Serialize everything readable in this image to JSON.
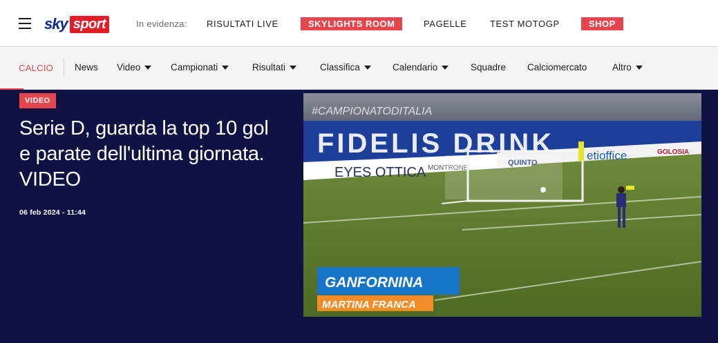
{
  "header": {
    "menu_icon": "hamburger-icon",
    "logo": {
      "sky": "sky",
      "sport": "sport"
    },
    "evidenza_label": "In evidenza:",
    "highlights": [
      {
        "label": "RISULTATI LIVE",
        "tag": false
      },
      {
        "label": "SKYLIGHTS ROOM",
        "tag": true
      },
      {
        "label": "PAGELLE",
        "tag": false
      },
      {
        "label": "TEST MOTOGP",
        "tag": false
      },
      {
        "label": "SHOP",
        "tag": true
      }
    ]
  },
  "subnav": {
    "section": "CALCIO",
    "items": [
      {
        "label": "News",
        "dropdown": false
      },
      {
        "label": "Video",
        "dropdown": true
      },
      {
        "label": "Campionati",
        "dropdown": true
      },
      {
        "label": "Risultati",
        "dropdown": true
      },
      {
        "label": "Classifica",
        "dropdown": true
      },
      {
        "label": "Calendario",
        "dropdown": true
      },
      {
        "label": "Squadre",
        "dropdown": false
      },
      {
        "label": "Calciomercato",
        "dropdown": false
      },
      {
        "label": "Altro",
        "dropdown": true
      }
    ]
  },
  "article": {
    "badge": "VIDEO",
    "title": "Serie D, guarda la top 10 gol e parate dell'ultima giornata. VIDEO",
    "date": "06 feb 2024 - 11:44"
  },
  "video": {
    "hashtag": "#CAMPIONATODITALIA",
    "player_name": "GANFORNINA",
    "team_name": "MARTINA FRANCA",
    "banner_text": "FIDELIS DRINK",
    "sponsors": [
      "EYES OTTICA",
      "MONTRONE",
      "QUINTO",
      "etioffice",
      "GOLOSIA"
    ]
  },
  "colors": {
    "brand_red": "#e5464e",
    "hero_bg": "#0f1242",
    "sky_blue": "#0a2a8c"
  }
}
